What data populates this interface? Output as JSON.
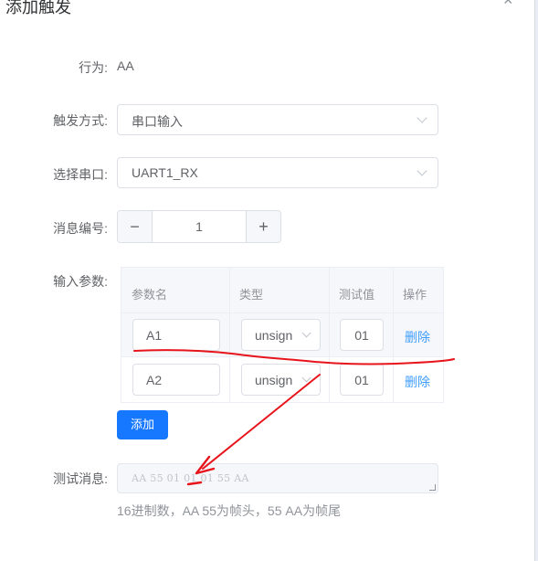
{
  "dialog": {
    "title": "添加触发",
    "close_icon": "×"
  },
  "form": {
    "behavior_label": "行为:",
    "behavior_value": "AA",
    "trigger_label": "触发方式:",
    "trigger_value": "串口输入",
    "serial_label": "选择串口:",
    "serial_value": "UART1_RX",
    "msgid_label": "消息编号:",
    "msgid_value": "1",
    "msgid_minus": "−",
    "msgid_plus": "+",
    "params_label": "输入参数:",
    "test_label": "测试消息:",
    "test_placeholder": "AA 55 01 01 01 55 AA",
    "hint": "16进制数，AA 55为帧头，55 AA为帧尾"
  },
  "params_table": {
    "columns": [
      "参数名",
      "类型",
      "测试值",
      "操作"
    ],
    "rows": [
      {
        "name": "A1",
        "type": "unsign",
        "test": "01",
        "action": "删除"
      },
      {
        "name": "A2",
        "type": "unsign",
        "test": "01",
        "action": "删除"
      }
    ]
  },
  "add_button": "添加",
  "colors": {
    "primary": "#1677ff",
    "link": "#409eff",
    "annotation": "#e8141b"
  }
}
